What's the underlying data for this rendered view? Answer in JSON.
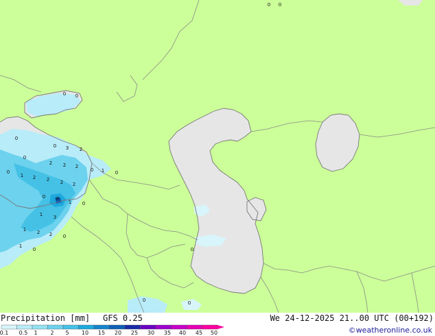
{
  "title": "Precipitation [mm]",
  "model": "GFS 0.25",
  "valid_time": "We 24-12-2025 21..00 UTC (00+192)",
  "credit": "©weatheronline.co.uk",
  "colors": {
    "land": "#ccff99",
    "water": "#e6e6e6",
    "border": "#8a8a8a",
    "coast": "#777777"
  },
  "scale": {
    "labels": [
      "0.1",
      "0.5",
      "1",
      "2",
      "5",
      "10",
      "15",
      "20",
      "25",
      "30",
      "35",
      "40",
      "45",
      "50"
    ],
    "colors": [
      "#d7f5fb",
      "#b8ecf8",
      "#94e0f4",
      "#6dd2ee",
      "#45c1e6",
      "#1ea9dc",
      "#1585cc",
      "#0f5fb6",
      "#1a2aa6",
      "#6a00c2",
      "#9c00cc",
      "#c800c8",
      "#e600b4",
      "#ff00a0"
    ]
  },
  "precip_labels": [
    {
      "v": "0"
    },
    {
      "v": "0"
    },
    {
      "v": "0"
    },
    {
      "v": "0"
    },
    {
      "v": "0"
    },
    {
      "v": "0"
    },
    {
      "v": "0"
    },
    {
      "v": "3"
    },
    {
      "v": "2"
    },
    {
      "v": "0"
    },
    {
      "v": "2"
    },
    {
      "v": "2"
    },
    {
      "v": "2"
    },
    {
      "v": "0"
    },
    {
      "v": "1"
    },
    {
      "v": "0"
    },
    {
      "v": "1"
    },
    {
      "v": "2"
    },
    {
      "v": "2"
    },
    {
      "v": "2"
    },
    {
      "v": "2"
    },
    {
      "v": "0"
    },
    {
      "v": "8"
    },
    {
      "v": "1"
    },
    {
      "v": "0"
    },
    {
      "v": "1"
    },
    {
      "v": "3"
    },
    {
      "v": "1"
    },
    {
      "v": "2"
    },
    {
      "v": "2"
    },
    {
      "v": "0"
    },
    {
      "v": "1"
    },
    {
      "v": "0"
    },
    {
      "v": "0"
    },
    {
      "v": "0"
    },
    {
      "v": "0"
    }
  ]
}
